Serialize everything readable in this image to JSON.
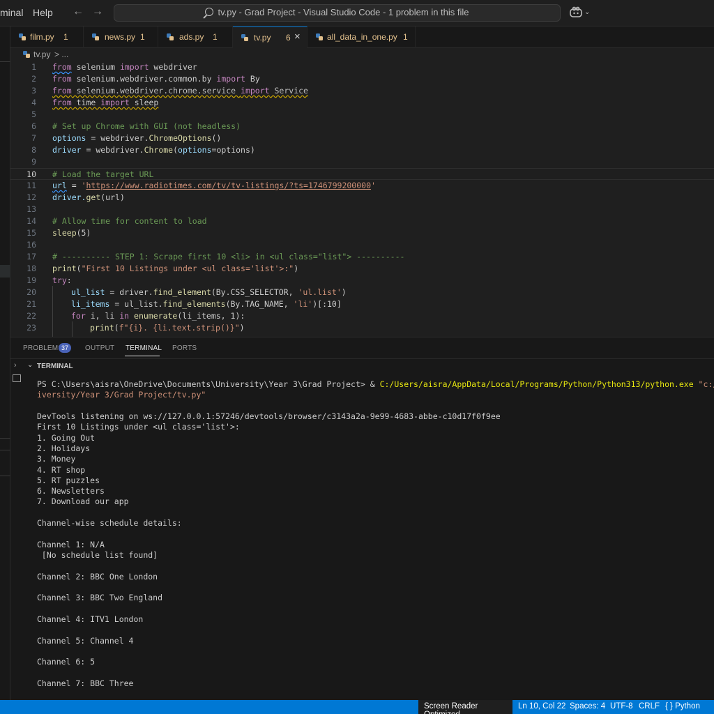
{
  "titlebar": {
    "menu": [
      "minal",
      "Help"
    ],
    "command_center": "tv.py - Grad Project - Visual Studio Code - 1 problem in this file"
  },
  "tabs": [
    {
      "label": "film.py",
      "count": "1"
    },
    {
      "label": "news.py",
      "count": "1"
    },
    {
      "label": "ads.py",
      "count": "1"
    },
    {
      "label": "tv.py",
      "count": "6"
    },
    {
      "label": "all_data_in_one.py",
      "count": "1"
    }
  ],
  "breadcrumb": {
    "file": "tv.py",
    "sep": "> ..."
  },
  "editor": {
    "line_numbers": [
      "1",
      "2",
      "3",
      "4",
      "5",
      "6",
      "7",
      "8",
      "9",
      "10",
      "11",
      "12",
      "13",
      "14",
      "15",
      "16",
      "17",
      "18",
      "19",
      "20",
      "21",
      "22",
      "23"
    ],
    "current_line": "10",
    "code": {
      "l1_kw1": "from",
      "l1_mod": " selenium ",
      "l1_kw2": "import",
      "l1_name": " webdriver",
      "l2_kw1": "from",
      "l2_mod": " selenium.webdriver.common.by ",
      "l2_kw2": "import",
      "l2_name": " By",
      "l3_kw1": "from",
      "l3_mod": " selenium.webdriver.chrome.service ",
      "l3_kw2": "import",
      "l3_name": " Service",
      "l4_kw1": "from",
      "l4_mod": " time ",
      "l4_kw2": "import",
      "l4_name": " sleep",
      "l6": "# Set up Chrome with GUI (not headless)",
      "l7_a": "options",
      "l7_b": " = webdriver.",
      "l7_fn": "ChromeOptions",
      "l7_c": "()",
      "l8_a": "driver",
      "l8_b": " = webdriver.",
      "l8_fn": "Chrome",
      "l8_c": "(",
      "l8_d": "options",
      "l8_e": "=options)",
      "l10": "# Load the target URL",
      "l11_a": "url",
      "l11_b": " = ",
      "l11_q1": "'",
      "l11_url": "https://www.radiotimes.com/tv/tv-listings/?ts=1746799200000",
      "l11_q2": "'",
      "l12_a": "driver.",
      "l12_fn": "get",
      "l12_b": "(url)",
      "l14": "# Allow time for content to load",
      "l15_fn": "sleep",
      "l15_b": "(5)",
      "l17": "# ---------- STEP 1: Scrape first 10 <li> in <ul class=\"list\"> ----------",
      "l18_fn": "print",
      "l18_b": "(",
      "l18_s": "\"First 10 Listings under <ul class='list'>:\"",
      "l18_c": ")",
      "l19_kw": "try",
      "l19_b": ":",
      "l20_a": "ul_list",
      "l20_b": " = driver.",
      "l20_fn": "find_element",
      "l20_c": "(By.CSS_SELECTOR, ",
      "l20_s": "'ul.list'",
      "l20_d": ")",
      "l21_a": "li_items",
      "l21_b": " = ul_list.",
      "l21_fn": "find_elements",
      "l21_c": "(By.TAG_NAME, ",
      "l21_s": "'li'",
      "l21_d": ")[:10]",
      "l22_kw": "for",
      "l22_b": " i, li ",
      "l22_kw2": "in",
      "l22_fn": " enumerate",
      "l22_c": "(li_items, 1):",
      "l23_fn": "print",
      "l23_b": "(",
      "l23_s": "f\"{i}. {li.text.strip()}\"",
      "l23_c": ")"
    }
  },
  "panel": {
    "tabs": [
      "PROBLEMS",
      "OUTPUT",
      "TERMINAL",
      "PORTS"
    ],
    "problems_count": "37",
    "terminal_header": "TERMINAL"
  },
  "terminal": {
    "prompt_a": "PS C:\\Users\\aisra\\OneDrive\\Documents\\University\\Year 3\\Grad Project> & ",
    "prompt_exe": "C:/Users/aisra/AppData/Local/Programs/Python/Python313/python.exe",
    "prompt_arg1": " \"c:/U",
    "prompt_arg2": "iversity/Year 3/Grad Project/tv.py\"",
    "output": [
      "DevTools listening on ws://127.0.0.1:57246/devtools/browser/c3143a2a-9e99-4683-abbe-c10d17f0f9ee",
      "First 10 Listings under <ul class='list'>:",
      "1. Going Out",
      "2. Holidays",
      "3. Money",
      "4. RT shop",
      "5. RT puzzles",
      "6. Newsletters",
      "7. Download our app",
      "Channel-wise schedule details:",
      "Channel 1: N/A",
      " [No schedule list found]",
      "Channel 2: BBC One London",
      "Channel 3: BBC Two England",
      "Channel 4: ITV1 London",
      "Channel 5: Channel 4",
      "Channel 6: 5",
      "Channel 7: BBC Three"
    ]
  },
  "statusbar": {
    "screen_reader": "Screen Reader Optimized",
    "position": "Ln 10, Col 22",
    "spaces": "Spaces: 4",
    "encoding": "UTF-8",
    "eol": "CRLF",
    "language": "{ } Python",
    "accent": "#0078d4"
  }
}
